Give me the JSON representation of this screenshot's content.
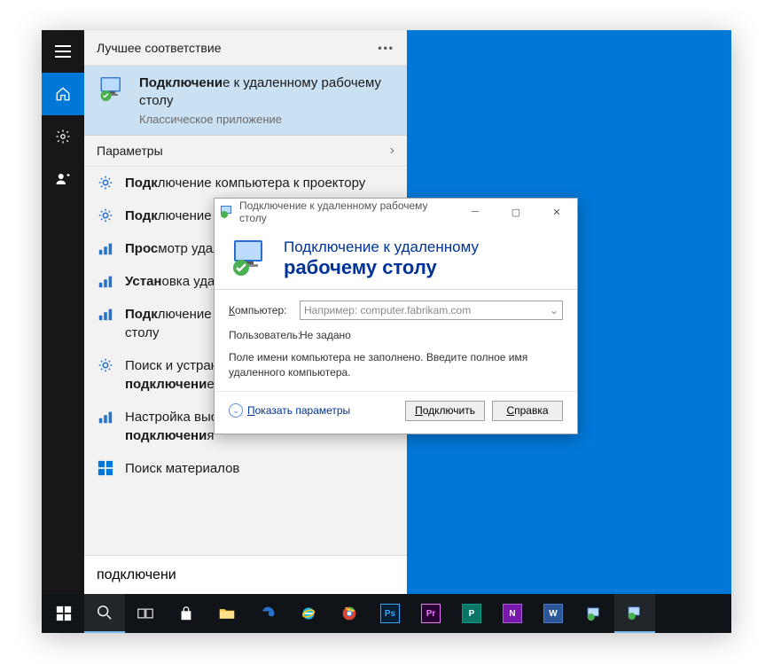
{
  "sidebar": {
    "items": [
      "menu",
      "home",
      "settings",
      "user"
    ]
  },
  "start": {
    "bestMatchHeader": "Лучшее соответствие",
    "bestMatch": {
      "titlePrefix": "Подключени",
      "titleRest": "е к удаленному рабочему столу",
      "subtitle": "Классическое приложение"
    },
    "paramsHeader": "Параметры",
    "results": [
      {
        "icon": "settings",
        "prefix": "Подк",
        "rest": "лючение компьютера к проектору"
      },
      {
        "icon": "settings",
        "prefix": "Подк",
        "rest": "лючение к рабочему месту домена"
      },
      {
        "icon": "settings-rdp",
        "prefix": "Прос",
        "rest": "мотр удаленных подключений"
      },
      {
        "icon": "settings-rdp",
        "prefix": "Устан",
        "rest": "овка удаленного подключения"
      },
      {
        "icon": "settings-rdp",
        "prefix": "Подк",
        "rest": "лючение к удаленному рабочему столу"
      },
      {
        "icon": "settings",
        "prefix": "Поиск и устранение проблем с сетью и ",
        "boldMid": "подключени",
        "rest": "ем"
      },
      {
        "icon": "settings-rdp",
        "prefix": "Настройка высокоскоростного ",
        "boldMid": "подключени",
        "rest": "я"
      }
    ],
    "storeResult": "Поиск материалов",
    "searchValue": "подключени"
  },
  "rdp": {
    "title": "Подключение к удаленному рабочему столу",
    "headerLine1": "Подключение к удаленному",
    "headerLine2": "рабочему столу",
    "computerLabel": "Компьютер:",
    "computerLabelKey": "К",
    "computerPlaceholder": "Например: computer.fabrikam.com",
    "userLabel": "Пользователь:",
    "userValue": "Не задано",
    "info": "Поле имени компьютера не заполнено. Введите полное имя удаленного компьютера.",
    "showParams": "Показать параметры",
    "showParamsKey": "П",
    "connectBtn": "Подключить",
    "connectKey": "П",
    "helpBtn": "Справка",
    "helpKey": "С"
  }
}
